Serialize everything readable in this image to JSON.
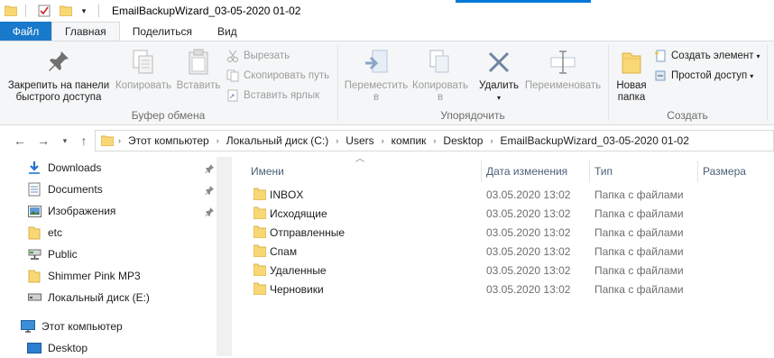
{
  "window": {
    "title": "EmailBackupWizard_03-05-2020 01-02"
  },
  "colors": {
    "accent": "#0078d7",
    "file_tab": "#1979ca",
    "folder": "#f8d775"
  },
  "ribbon": {
    "tabs": [
      "Файл",
      "Главная",
      "Поделиться",
      "Вид"
    ],
    "clipboard": {
      "pin_label_1": "Закрепить на панели",
      "pin_label_2": "быстрого доступа",
      "copy": "Копировать",
      "paste": "Вставить",
      "cut": "Вырезать",
      "copy_path": "Скопировать путь",
      "paste_shortcut": "Вставить ярлык",
      "group": "Буфер обмена"
    },
    "organize": {
      "move_1": "Переместить",
      "move_2": "в",
      "copy_1": "Копировать",
      "copy_2": "в",
      "delete": "Удалить",
      "rename": "Переименовать",
      "group": "Упорядочить"
    },
    "create": {
      "new_folder_1": "Новая",
      "new_folder_2": "папка",
      "new_item": "Создать элемент",
      "easy_access": "Простой доступ",
      "group": "Создать"
    }
  },
  "address": {
    "crumbs": [
      "Этот компьютер",
      "Локальный диск (C:)",
      "Users",
      "компик",
      "Desktop",
      "EmailBackupWizard_03-05-2020 01-02"
    ]
  },
  "nav": {
    "items": [
      {
        "label": "Downloads",
        "icon": "download-icon"
      },
      {
        "label": "Documents",
        "icon": "documents-icon"
      },
      {
        "label": "Изображения",
        "icon": "pictures-icon"
      },
      {
        "label": "etc",
        "icon": "folder-icon"
      },
      {
        "label": "Public",
        "icon": "network-drive-icon"
      },
      {
        "label": "Shimmer Pink MP3",
        "icon": "folder-icon"
      },
      {
        "label": "Локальный диск (E:)",
        "icon": "drive-icon"
      },
      {
        "label": "Этот компьютер",
        "icon": "computer-icon"
      },
      {
        "label": "Desktop",
        "icon": "desktop-icon"
      }
    ]
  },
  "files": {
    "columns": [
      "Имени",
      "Дата изменения",
      "Тип",
      "Размера"
    ],
    "rows": [
      {
        "name": "INBOX",
        "date": "03.05.2020 13:02",
        "type": "Папка с файлами"
      },
      {
        "name": "Исходящие",
        "date": "03.05.2020 13:02",
        "type": "Папка с файлами"
      },
      {
        "name": "Отправленные",
        "date": "03.05.2020 13:02",
        "type": "Папка с файлами"
      },
      {
        "name": "Спам",
        "date": "03.05.2020 13:02",
        "type": "Папка с файлами"
      },
      {
        "name": "Удаленные",
        "date": "03.05.2020 13:02",
        "type": "Папка с файлами"
      },
      {
        "name": "Черновики",
        "date": "03.05.2020 13:02",
        "type": "Папка с файлами"
      }
    ]
  }
}
